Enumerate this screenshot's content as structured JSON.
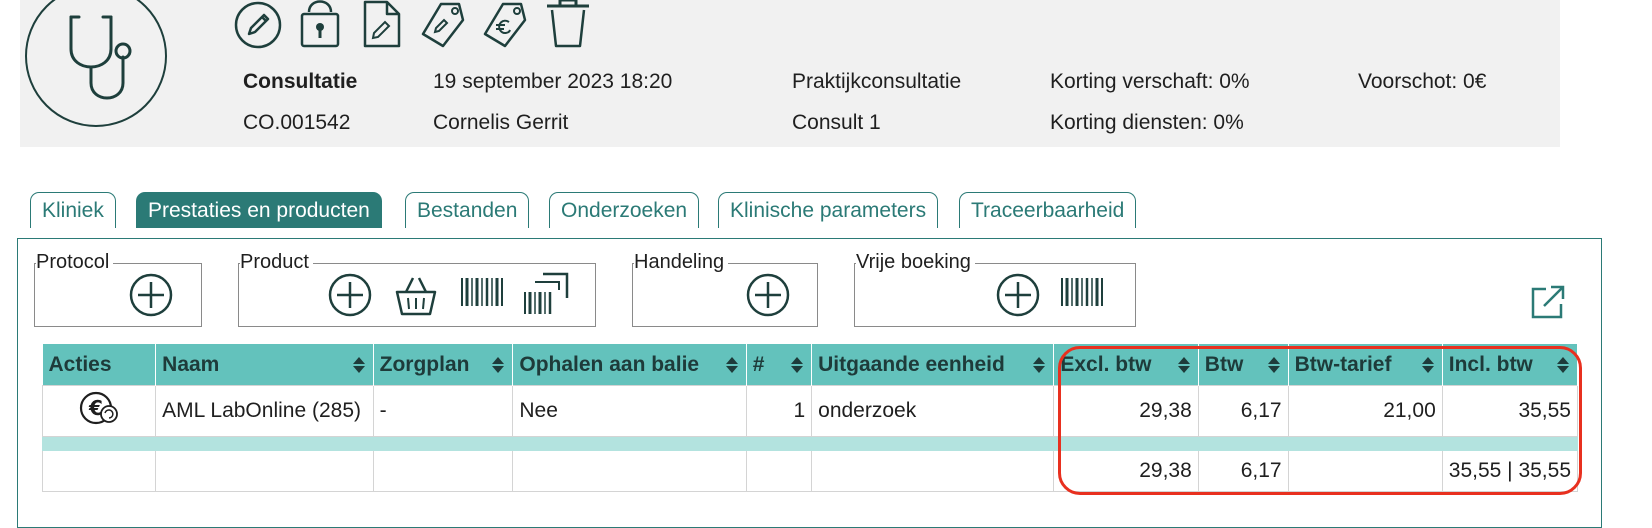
{
  "header": {
    "type_label": "Consultatie",
    "code": "CO.001542",
    "datetime": "19 september 2023 18:20",
    "person": "Cornelis Gerrit",
    "consult_type": "Praktijkconsultatie",
    "consult_name": "Consult 1",
    "discount_provided": "Korting verschaft: 0%",
    "discount_services": "Korting diensten: 0%",
    "advance": "Voorschot: 0€"
  },
  "toolbar_icons": [
    "edit-icon",
    "lock-icon",
    "document-edit-icon",
    "tag-edit-icon",
    "tag-euro-icon",
    "trash-icon"
  ],
  "tabs": [
    {
      "label": "Kliniek",
      "active": false
    },
    {
      "label": "Prestaties en producten",
      "active": true
    },
    {
      "label": "Bestanden",
      "active": false
    },
    {
      "label": "Onderzoeken",
      "active": false
    },
    {
      "label": "Klinische parameters",
      "active": false
    },
    {
      "label": "Traceerbaarheid",
      "active": false
    }
  ],
  "groups": {
    "protocol": "Protocol",
    "product": "Product",
    "handeling": "Handeling",
    "vrije_boeking": "Vrije boeking"
  },
  "table": {
    "columns": [
      "Acties",
      "Naam",
      "Zorgplan",
      "Ophalen aan balie",
      "#",
      "Uitgaande eenheid",
      "Excl. btw",
      "Btw",
      "Btw-tarief",
      "Incl. btw"
    ],
    "rows": [
      {
        "naam": "AML LabOnline (285)",
        "zorgplan": "-",
        "ophalen": "Nee",
        "aantal": "1",
        "eenheid": "onderzoek",
        "excl": "29,38",
        "btw": "6,17",
        "tarief": "21,00",
        "incl": "35,55"
      }
    ],
    "totals": {
      "excl": "29,38",
      "btw": "6,17",
      "incl": "35,55 | 35,55"
    }
  },
  "colors": {
    "accent": "#2b7a76",
    "header_bg": "#63c2bc",
    "highlight": "#e8301f"
  }
}
